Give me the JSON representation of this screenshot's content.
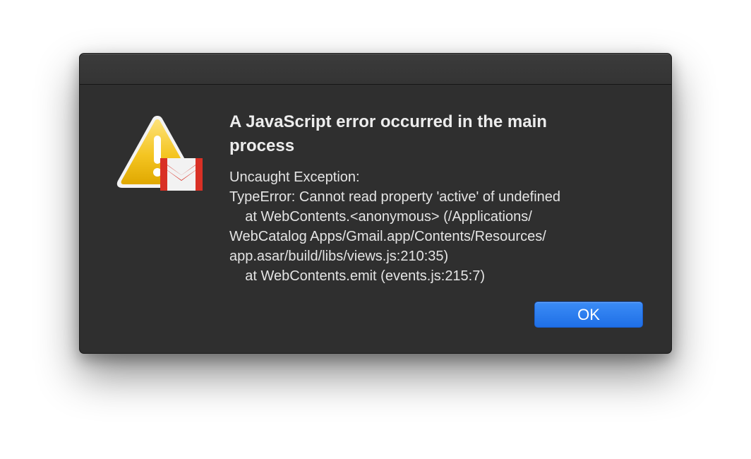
{
  "dialog": {
    "title": "A JavaScript error occurred in the main process",
    "message_lines": [
      "Uncaught Exception:",
      "TypeError: Cannot read property 'active' of undefined",
      "    at WebContents.<anonymous> (/Applications/",
      "WebCatalog Apps/Gmail.app/Contents/Resources/",
      "app.asar/build/libs/views.js:210:35)",
      "    at WebContents.emit (events.js:215:7)"
    ],
    "ok_label": "OK",
    "icon": "warning-triangle-with-gmail-icon"
  },
  "colors": {
    "dialog_background": "#2f2f2f",
    "text": "#e4e4e4",
    "button_accent": "#2a7cf0",
    "warning_yellow": "#f3c21c",
    "gmail_red": "#d93025"
  }
}
